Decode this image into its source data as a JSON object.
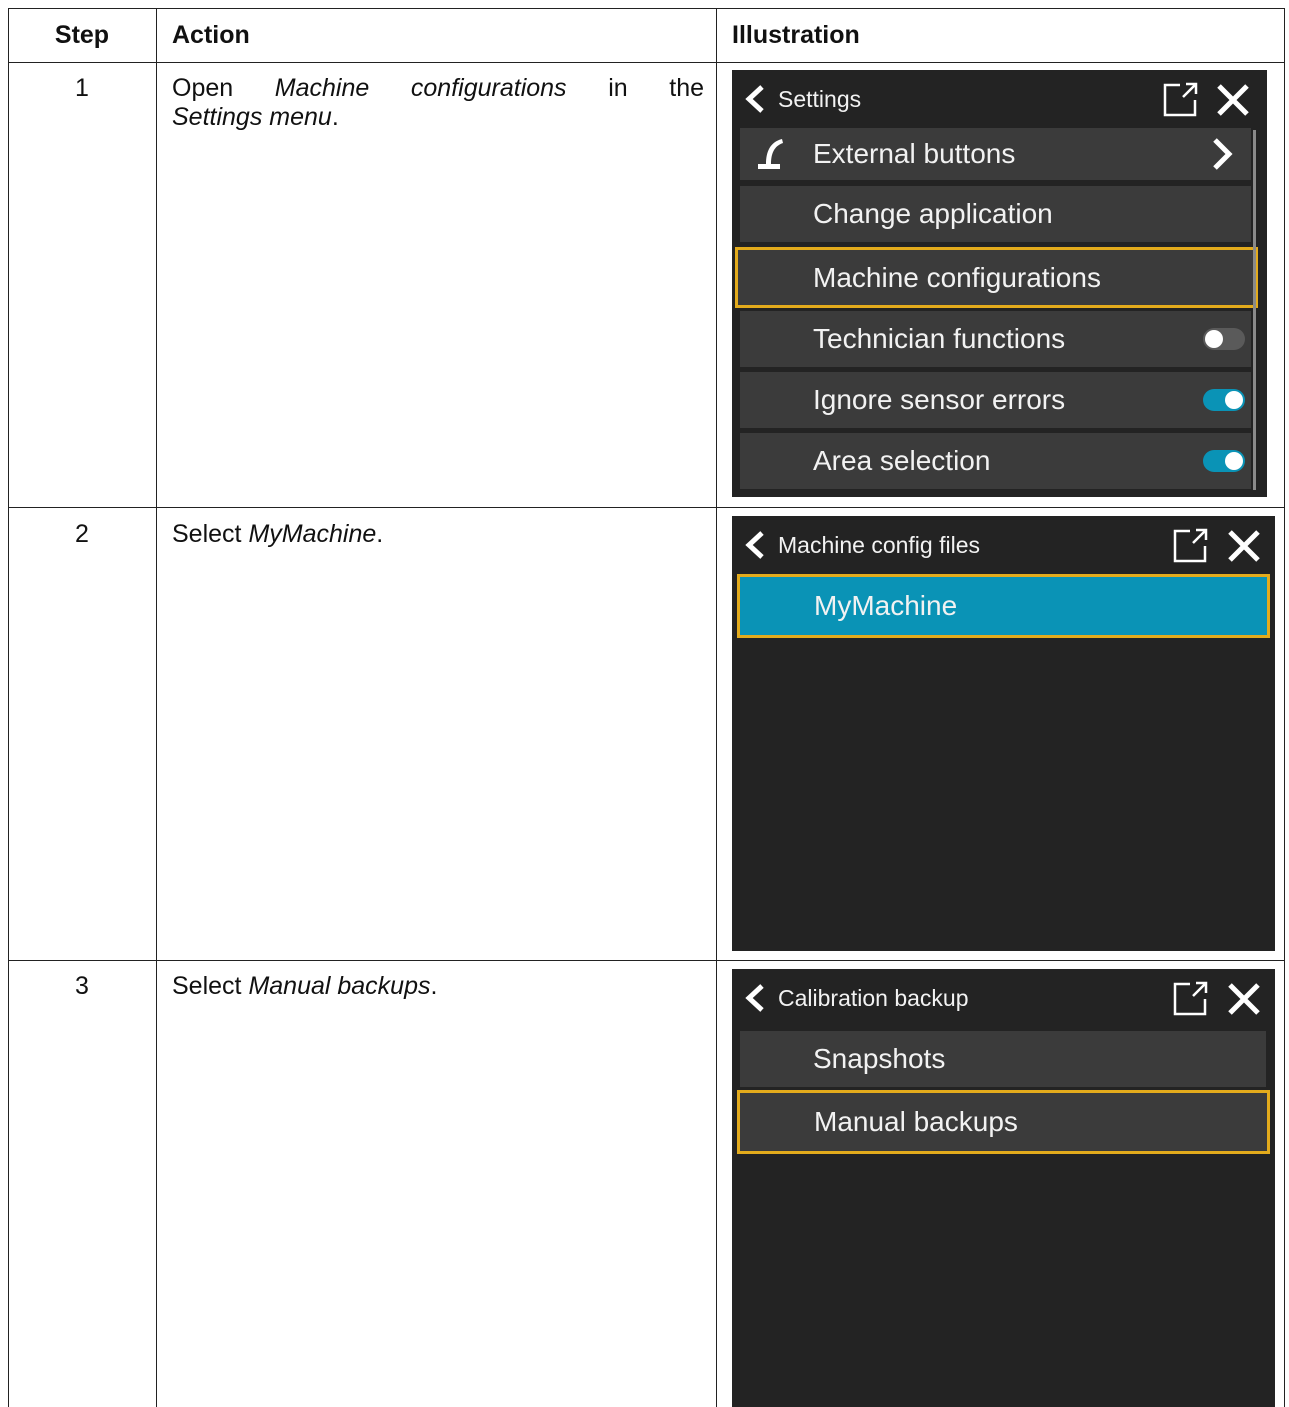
{
  "header": {
    "step": "Step",
    "action": "Action",
    "illustration": "Illustration"
  },
  "steps": [
    {
      "number": "1",
      "action": {
        "prefix": "Open",
        "italic1": "Machine configurations",
        "mid": "in the",
        "italic2": "Settings menu",
        "suffix": "."
      },
      "screen": {
        "title": "Settings",
        "items": [
          {
            "label": "External buttons",
            "icon": "joystick-icon",
            "trailing": "chevron-right-icon"
          },
          {
            "label": "Change application"
          },
          {
            "label": "Machine configurations",
            "highlighted": true
          },
          {
            "label": "Technician functions",
            "toggle": "off"
          },
          {
            "label": "Ignore sensor errors",
            "toggle": "on"
          },
          {
            "label": "Area selection",
            "toggle": "on"
          }
        ]
      }
    },
    {
      "number": "2",
      "action": {
        "prefix": "Select",
        "italic1": "MyMachine",
        "suffix": "."
      },
      "screen": {
        "title": "Machine config files",
        "items": [
          {
            "label": "MyMachine",
            "highlighted": true,
            "selected": true
          }
        ]
      }
    },
    {
      "number": "3",
      "action": {
        "prefix": "Select",
        "italic1": "Manual backups",
        "suffix": "."
      },
      "screen": {
        "title": "Calibration backup",
        "items": [
          {
            "label": "Snapshots"
          },
          {
            "label": "Manual backups",
            "highlighted": true
          }
        ]
      }
    }
  ],
  "colors": {
    "panel_bg": "#232323",
    "row_bg": "#3b3b3b",
    "highlight": "#e3ab1c",
    "accent": "#0a93b6"
  },
  "icons": [
    "back-icon",
    "open-external-icon",
    "close-icon",
    "joystick-icon",
    "chevron-right-icon"
  ]
}
